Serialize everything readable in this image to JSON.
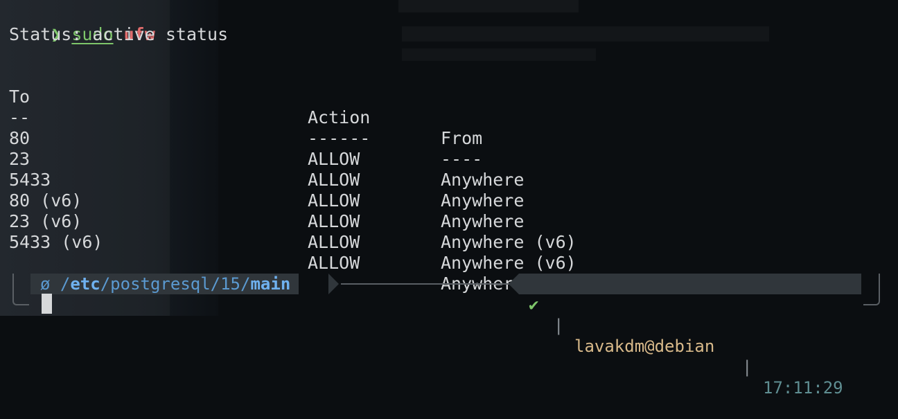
{
  "command": {
    "prompt_symbol": "❯",
    "sudo": "sudo",
    "program": "ufw",
    "argument": "status"
  },
  "status_line": "Status: active",
  "table": {
    "headers": [
      "To",
      "Action",
      "From"
    ],
    "underlines": [
      "--",
      "------",
      "----"
    ],
    "rows": [
      [
        "80",
        "ALLOW",
        "Anywhere"
      ],
      [
        "23",
        "ALLOW",
        "Anywhere"
      ],
      [
        "5433",
        "ALLOW",
        "Anywhere"
      ],
      [
        "80 (v6)",
        "ALLOW",
        "Anywhere (v6)"
      ],
      [
        "23 (v6)",
        "ALLOW",
        "Anywhere (v6)"
      ],
      [
        "5433 (v6)",
        "ALLOW",
        "Anywhere (v6)"
      ]
    ]
  },
  "prompt_bar": {
    "dir_icon": "ø",
    "path_prefix": "/",
    "path_etc": "etc",
    "path_middle": "/postgresql/15/",
    "path_current": "main",
    "status_icon": "✔",
    "separator": "|",
    "user_host": "lavakdm@debian",
    "time": "17:11:29"
  },
  "colors": {
    "green": "#7ec66a",
    "red": "#e06c6c",
    "blue": "#5b9ad1",
    "tan": "#d8b98a",
    "teal": "#5f8e92"
  }
}
